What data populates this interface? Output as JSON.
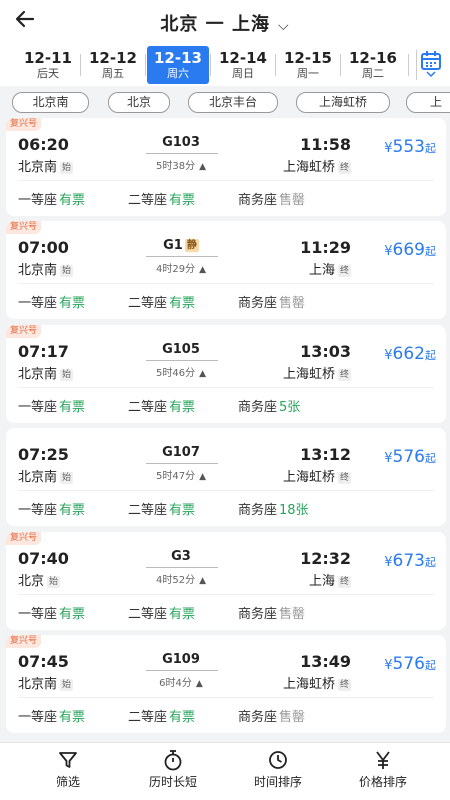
{
  "header": {
    "title": "北京 一 上海"
  },
  "dates": [
    {
      "date": "12-11",
      "weekday": "后天",
      "selected": false
    },
    {
      "date": "12-12",
      "weekday": "周五",
      "selected": false
    },
    {
      "date": "12-13",
      "weekday": "周六",
      "selected": true
    },
    {
      "date": "12-14",
      "weekday": "周日",
      "selected": false
    },
    {
      "date": "12-15",
      "weekday": "周一",
      "selected": false
    },
    {
      "date": "12-16",
      "weekday": "周二",
      "selected": false
    }
  ],
  "stations": [
    "北京南",
    "北京",
    "北京丰台",
    "上海虹桥",
    "上"
  ],
  "trains": [
    {
      "badge": "复兴号",
      "dep_time": "06:20",
      "dep_station": "北京南",
      "dep_tag": "始",
      "train_no": "G103",
      "still": "",
      "duration": "5时38分",
      "arr_time": "11:58",
      "arr_station": "上海虹桥",
      "arr_tag": "终",
      "price": "553",
      "price_suffix": "起",
      "yen": "¥",
      "seats": [
        {
          "label": "一等座",
          "status": "有票",
          "kind": "av"
        },
        {
          "label": "二等座",
          "status": "有票",
          "kind": "av"
        },
        {
          "label": "商务座",
          "status": "售罄",
          "kind": "so"
        }
      ]
    },
    {
      "badge": "复兴号",
      "dep_time": "07:00",
      "dep_station": "北京南",
      "dep_tag": "始",
      "train_no": "G1",
      "still": "静",
      "duration": "4时29分",
      "arr_time": "11:29",
      "arr_station": "上海",
      "arr_tag": "终",
      "price": "669",
      "price_suffix": "起",
      "yen": "¥",
      "seats": [
        {
          "label": "一等座",
          "status": "有票",
          "kind": "av"
        },
        {
          "label": "二等座",
          "status": "有票",
          "kind": "av"
        },
        {
          "label": "商务座",
          "status": "售罄",
          "kind": "so"
        }
      ]
    },
    {
      "badge": "复兴号",
      "dep_time": "07:17",
      "dep_station": "北京南",
      "dep_tag": "始",
      "train_no": "G105",
      "still": "",
      "duration": "5时46分",
      "arr_time": "13:03",
      "arr_station": "上海虹桥",
      "arr_tag": "终",
      "price": "662",
      "price_suffix": "起",
      "yen": "¥",
      "seats": [
        {
          "label": "一等座",
          "status": "有票",
          "kind": "av"
        },
        {
          "label": "二等座",
          "status": "有票",
          "kind": "av"
        },
        {
          "label": "商务座",
          "status": "5张",
          "kind": "av"
        }
      ]
    },
    {
      "badge": "",
      "dep_time": "07:25",
      "dep_station": "北京南",
      "dep_tag": "始",
      "train_no": "G107",
      "still": "",
      "duration": "5时47分",
      "arr_time": "13:12",
      "arr_station": "上海虹桥",
      "arr_tag": "终",
      "price": "576",
      "price_suffix": "起",
      "yen": "¥",
      "seats": [
        {
          "label": "一等座",
          "status": "有票",
          "kind": "av"
        },
        {
          "label": "二等座",
          "status": "有票",
          "kind": "av"
        },
        {
          "label": "商务座",
          "status": "18张",
          "kind": "av"
        }
      ]
    },
    {
      "badge": "复兴号",
      "dep_time": "07:40",
      "dep_station": "北京",
      "dep_tag": "始",
      "train_no": "G3",
      "still": "",
      "duration": "4时52分",
      "arr_time": "12:32",
      "arr_station": "上海",
      "arr_tag": "终",
      "price": "673",
      "price_suffix": "起",
      "yen": "¥",
      "seats": [
        {
          "label": "一等座",
          "status": "有票",
          "kind": "av"
        },
        {
          "label": "二等座",
          "status": "有票",
          "kind": "av"
        },
        {
          "label": "商务座",
          "status": "售罄",
          "kind": "so"
        }
      ]
    },
    {
      "badge": "复兴号",
      "dep_time": "07:45",
      "dep_station": "北京南",
      "dep_tag": "始",
      "train_no": "G109",
      "still": "",
      "duration": "6时4分",
      "arr_time": "13:49",
      "arr_station": "上海虹桥",
      "arr_tag": "终",
      "price": "576",
      "price_suffix": "起",
      "yen": "¥",
      "seats": [
        {
          "label": "一等座",
          "status": "有票",
          "kind": "av"
        },
        {
          "label": "二等座",
          "status": "有票",
          "kind": "av"
        },
        {
          "label": "商务座",
          "status": "售罄",
          "kind": "so"
        }
      ]
    }
  ],
  "bottom_tabs": [
    {
      "label": "筛选",
      "icon": "filter-icon"
    },
    {
      "label": "历时长短",
      "icon": "stopwatch-icon"
    },
    {
      "label": "时间排序",
      "icon": "clock-icon"
    },
    {
      "label": "价格排序",
      "icon": "yen-icon"
    }
  ],
  "colors": {
    "accent": "#2b7bf0",
    "available": "#27a55b",
    "soldout": "#999999",
    "badge": "#e2683f"
  }
}
